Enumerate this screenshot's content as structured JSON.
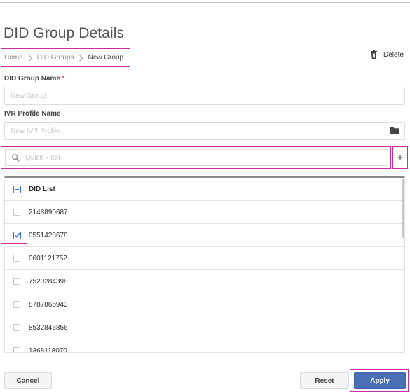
{
  "page": {
    "title": "DID Group Details"
  },
  "breadcrumb": {
    "home": "Home",
    "section": "DID Groups",
    "current": "New Group"
  },
  "toolbar": {
    "delete_label": "Delete"
  },
  "form": {
    "group_name_label": "DID Group Name",
    "required_mark": "*",
    "group_name_placeholder": "New Group",
    "group_name_value": "",
    "ivr_label": "IVR Profile Name",
    "ivr_placeholder": "New IVR Profile",
    "ivr_value": ""
  },
  "filter": {
    "placeholder": "Quick Filter",
    "value": "",
    "add_label": "+"
  },
  "table": {
    "header": "DID List",
    "rows": [
      {
        "did": "2148890687",
        "checked": false
      },
      {
        "did": "0551428678",
        "checked": true
      },
      {
        "did": "0601121752",
        "checked": false
      },
      {
        "did": "7520284398",
        "checked": false
      },
      {
        "did": "8787865943",
        "checked": false
      },
      {
        "did": "8532846856",
        "checked": false
      },
      {
        "did": "1368118070",
        "checked": false
      }
    ]
  },
  "footer": {
    "cancel_label": "Cancel",
    "reset_label": "Reset",
    "apply_label": "Apply"
  },
  "colors": {
    "accent": "#4a6fb5",
    "checkbox_blue": "#3a7bd5",
    "highlight": "#cc2d9a",
    "required": "#d9534f"
  },
  "icons": {
    "delete": "trash-icon",
    "ivr_browse": "folder-icon",
    "filter": "search-icon",
    "add": "plus-icon"
  }
}
